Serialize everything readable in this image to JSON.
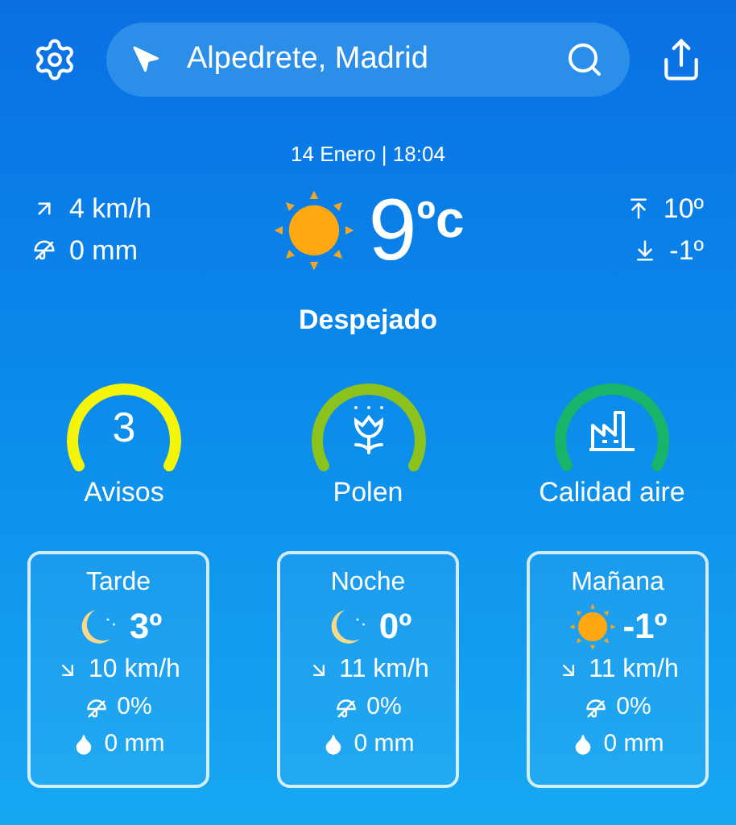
{
  "search": {
    "value": "Alpedrete, Madrid"
  },
  "date": "14 Enero | 18:04",
  "current": {
    "wind": "4 km/h",
    "rain": "0 mm",
    "temperature": "9",
    "unit": "ºc",
    "max": "10º",
    "min": "-1º",
    "condition": "Despejado",
    "kind": "sun"
  },
  "gauges": [
    {
      "kind": "number",
      "value": "3",
      "label": "Avisos",
      "color": "#f5f50a"
    },
    {
      "kind": "pollen",
      "label": "Polen",
      "color": "#8cc21c"
    },
    {
      "kind": "air",
      "label": "Calidad aire",
      "color": "#17b46a"
    }
  ],
  "periods": [
    {
      "name": "Tarde",
      "kind": "moon",
      "temperature": "3º",
      "wind": "10 km/h",
      "rain_chance": "0%",
      "rain": "0 mm"
    },
    {
      "name": "Noche",
      "kind": "moon",
      "temperature": "0º",
      "wind": "11 km/h",
      "rain_chance": "0%",
      "rain": "0 mm"
    },
    {
      "name": "Mañana",
      "kind": "sun",
      "temperature": "-1º",
      "wind": "11 km/h",
      "rain_chance": "0%",
      "rain": "0 mm"
    }
  ]
}
